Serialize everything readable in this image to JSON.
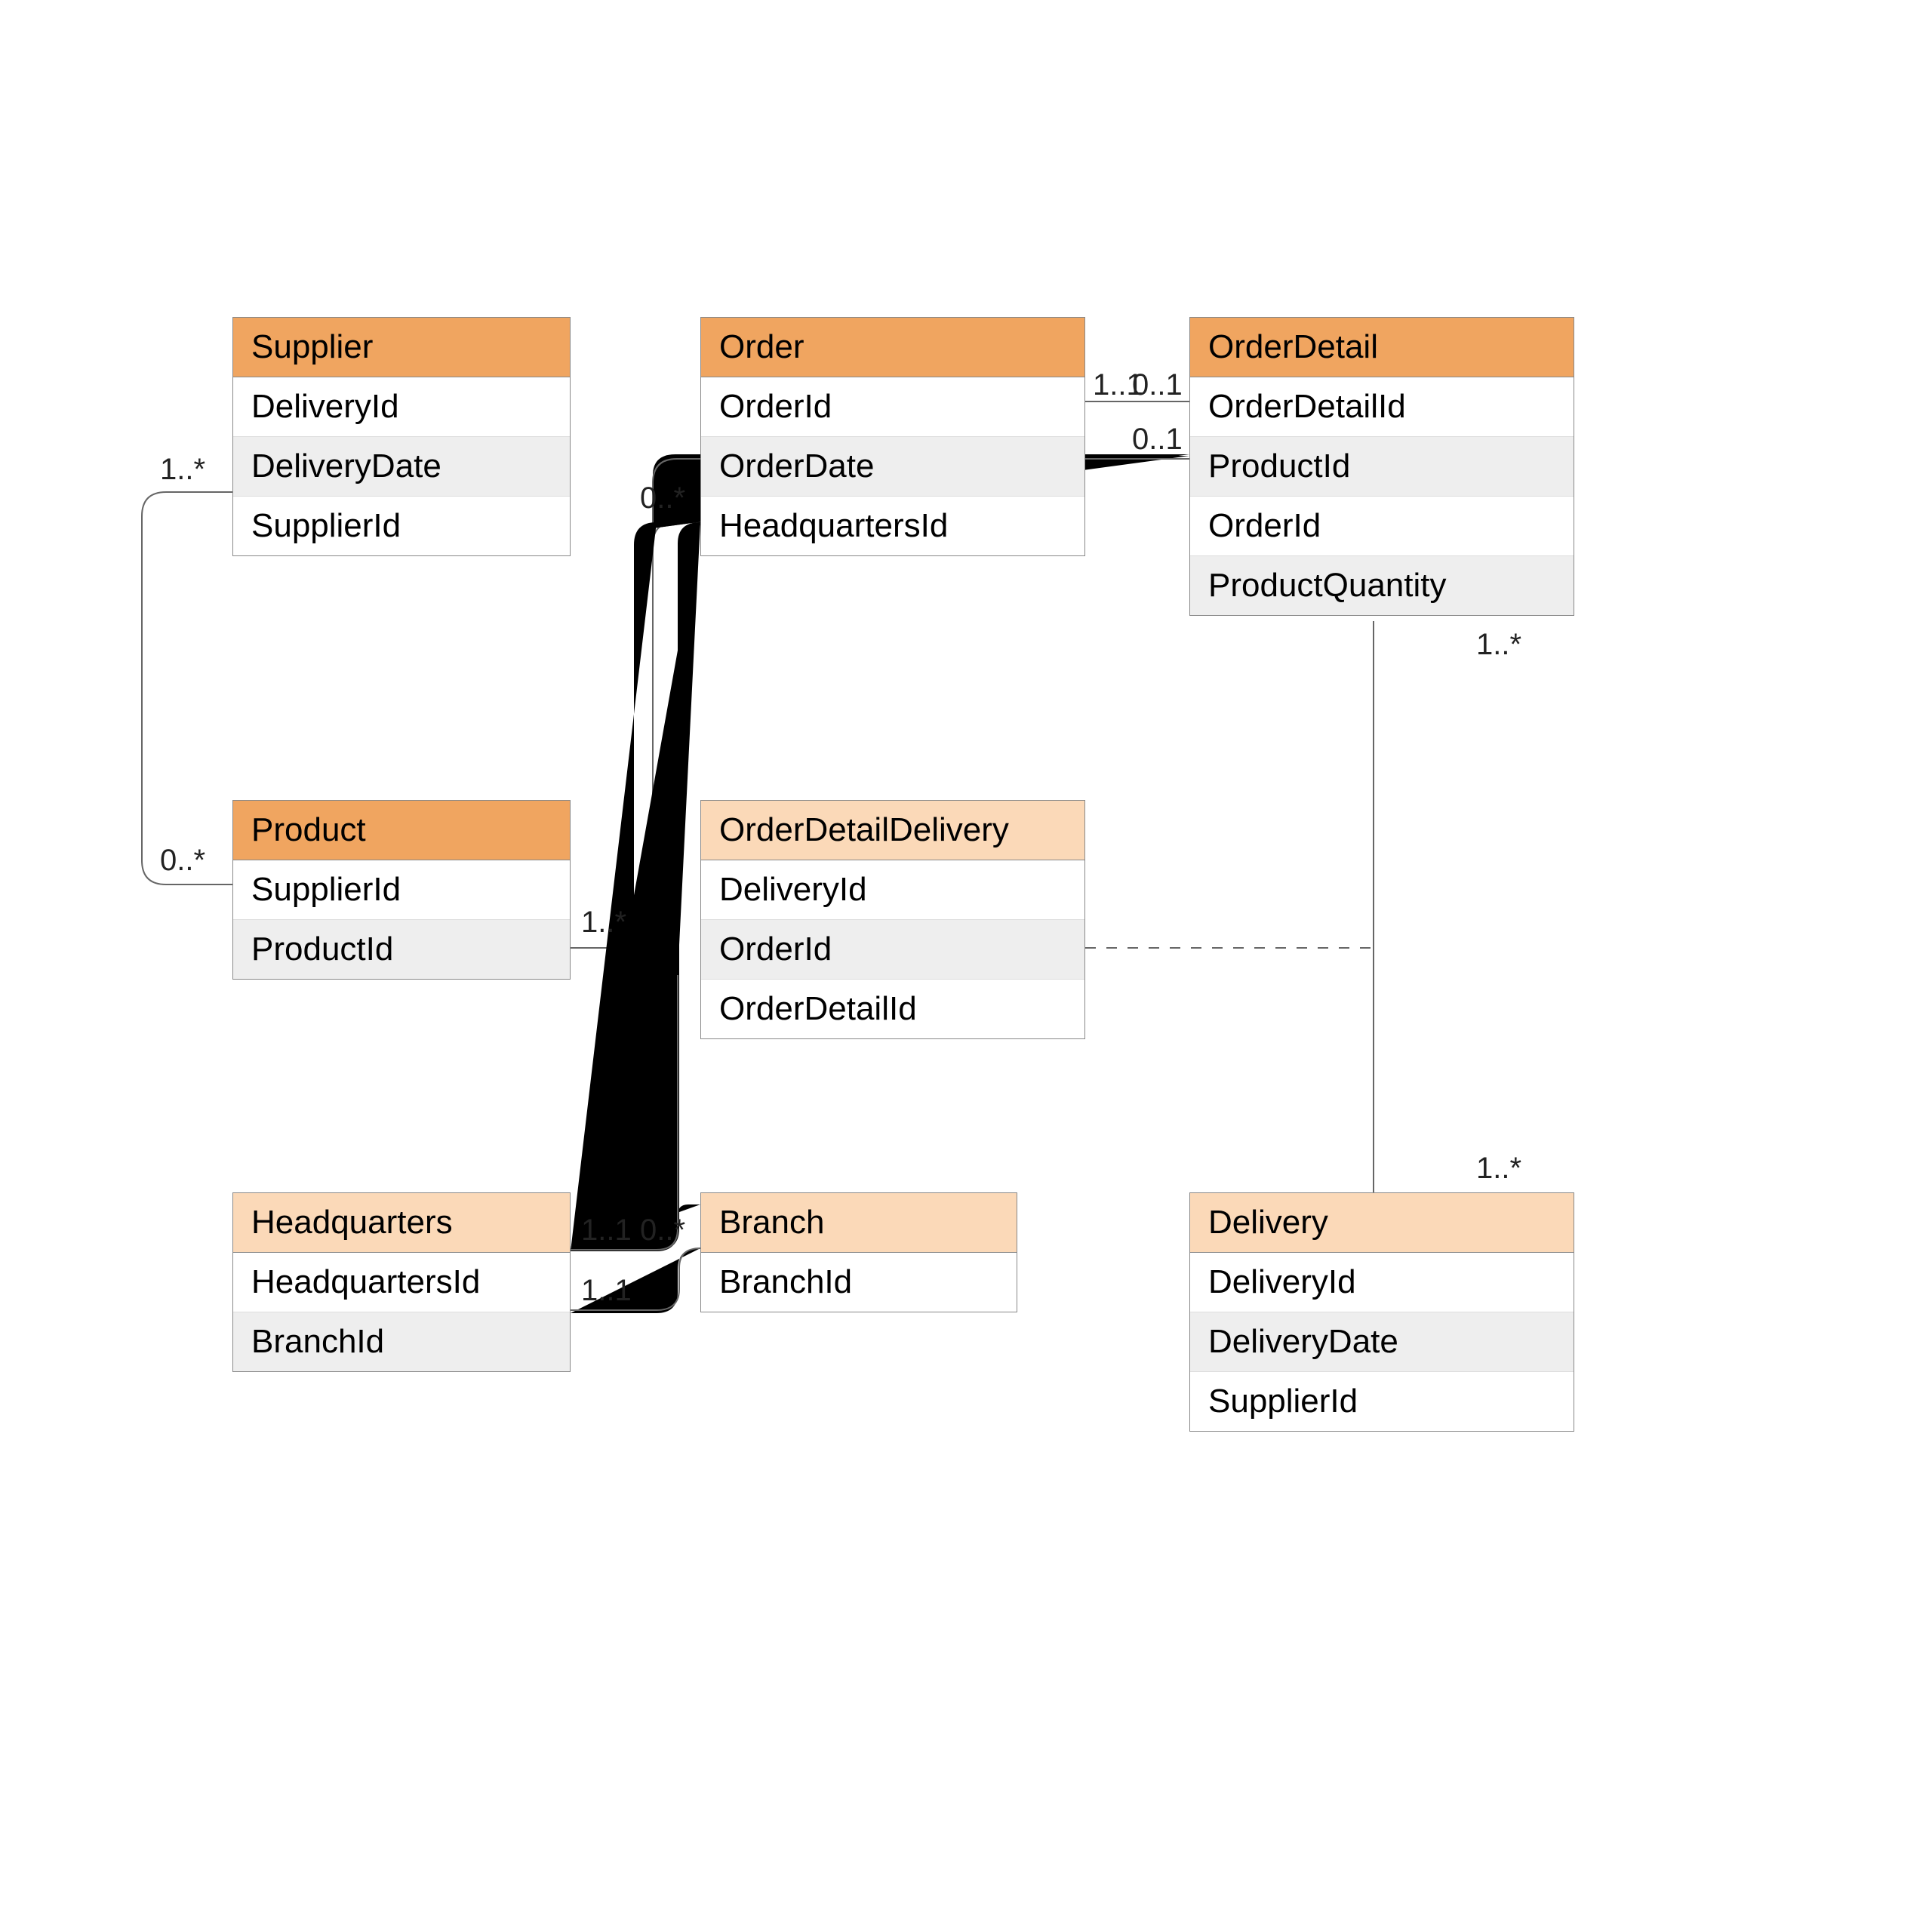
{
  "entities": {
    "supplier": {
      "title": "Supplier",
      "rows": [
        "DeliveryId",
        "DeliveryDate",
        "SupplierId"
      ]
    },
    "order": {
      "title": "Order",
      "rows": [
        "OrderId",
        "OrderDate",
        "HeadquartersId"
      ]
    },
    "orderDetail": {
      "title": "OrderDetail",
      "rows": [
        "OrderDetailId",
        "ProductId",
        "OrderId",
        "ProductQuantity"
      ]
    },
    "product": {
      "title": "Product",
      "rows": [
        "SupplierId",
        "ProductId"
      ]
    },
    "orderDetailDelivery": {
      "title": "OrderDetailDelivery",
      "rows": [
        "DeliveryId",
        "OrderId",
        "OrderDetailId"
      ]
    },
    "headquarters": {
      "title": "Headquarters",
      "rows": [
        "HeadquartersId",
        "BranchId"
      ]
    },
    "branch": {
      "title": "Branch",
      "rows": [
        "BranchId"
      ]
    },
    "delivery": {
      "title": "Delivery",
      "rows": [
        "DeliveryId",
        "DeliveryDate",
        "SupplierId"
      ]
    }
  },
  "multiplicities": {
    "supplier_out": "1..*",
    "product_in": "0..*",
    "product_out": "1..*",
    "order_in": "0..*",
    "order_right": "1..1",
    "orderdetail_left_top": "0..1",
    "orderdetail_left2": "0..1",
    "orderdetail_bottom": "1..*",
    "delivery_top": "1..*",
    "headquarters_right1": "1..1",
    "headquarters_right2": "1..1",
    "branch_left": "0..*"
  }
}
